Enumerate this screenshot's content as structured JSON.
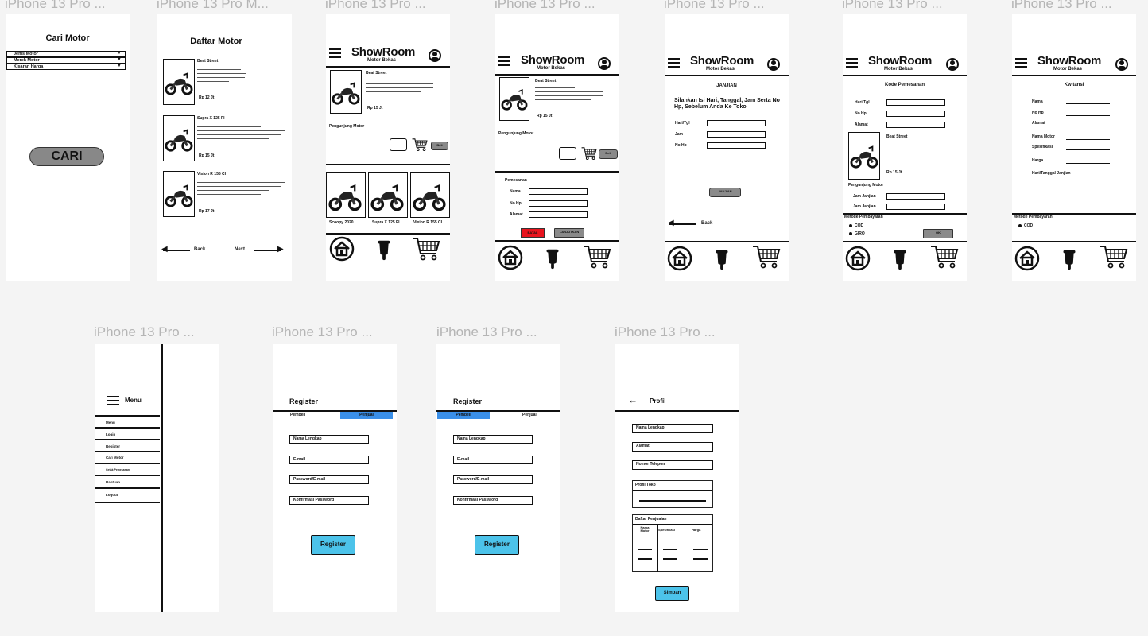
{
  "frame_titles": [
    "iPhone 13 Pro ...",
    "iPhone 13 Pro M...",
    "iPhone 13 Pro ...",
    "iPhone 13 Pro ...",
    "iPhone 13 Pro ...",
    "iPhone 13 Pro ...",
    "iPhone 13 Pro ...",
    "iPhone 13 Pro ...",
    "iPhone 13 Pro ...",
    "iPhone 13 Pro ...",
    "iPhone 13 Pro ..."
  ],
  "brand": {
    "name": "ShowRoom",
    "sub": "Motor Bekas"
  },
  "cari": {
    "title": "Cari Motor",
    "options": [
      "Jenis Motor",
      "Merek Motor",
      "Kisaran Harga"
    ],
    "button": "CARI"
  },
  "daftar": {
    "title": "Daftar Motor",
    "items": [
      {
        "name": "Beat Street",
        "price": "Rp 12 Jt"
      },
      {
        "name": "Supra X 125 FI",
        "price": "Rp 15 Jt"
      },
      {
        "name": "Vixion R 155 CI",
        "price": "Rp 17 Jt"
      }
    ],
    "back": "Back",
    "next": "Next"
  },
  "detail": {
    "item_name": "Beat Street",
    "price": "Rp 15 Jt",
    "pengunjung": "Pengunjung Motor",
    "beli": "Beli",
    "thumbs": [
      "Scoopy 2020",
      "Supra X 125 FI",
      "Vixion R 155 CI"
    ]
  },
  "pemesanan": {
    "item_name": "Beat Street",
    "price": "Rp 15 Jt",
    "pengunjung": "Pengunjung Motor",
    "section": "Pemesanan",
    "fields": [
      "Nama",
      "No Hp",
      "Alamat"
    ],
    "batal": "BATAL",
    "lanjut": "LANJUTKAN",
    "beli": "Beli"
  },
  "janjian": {
    "title": "JANJIAN",
    "desc": "Silahkan Isi Hari, Tanggal, Jam Serta No Hp, Sebelum Anda Ke Toko",
    "fields": [
      "Hari/Tgl",
      "Jam",
      "No Hp"
    ],
    "button": "JANJIAN",
    "back": "Back"
  },
  "kode": {
    "title": "Kode Pemesanan",
    "fields": [
      "Hari/Tgl",
      "No Hp",
      "Alamat"
    ],
    "item_name": "Beat Street",
    "price": "Rp 15 Jt",
    "pengunjung": "Pengunjung Motor",
    "jam_fields": [
      "Jam Janjian",
      "Jam Janjian"
    ],
    "metode": "Metode Pembayaran",
    "options": [
      "COD",
      "GIRO"
    ],
    "ok": "OK"
  },
  "kwitansi": {
    "title": "Kwitansi",
    "fields": [
      "Nama",
      "No Hp",
      "Alamat",
      "Nama Motor",
      "Spesifikasi",
      "Harga",
      "Hari/Tanggal Janjian"
    ],
    "metode": "Metode Pembayaran",
    "option": "COD"
  },
  "menu": {
    "title": "Menu",
    "items": [
      "Menu",
      "Login",
      "Register",
      "Cari Motor",
      "Cetak Pemesanan",
      "Bantuan",
      "Logout"
    ]
  },
  "register1": {
    "title": "Register",
    "tabs": [
      "Pembeli",
      "Penjual"
    ],
    "fields": [
      "Nama Lengkap",
      "E-mail",
      "Password/E-mail",
      "Konfirmasi Password"
    ],
    "button": "Register"
  },
  "register2": {
    "title": "Register",
    "tabs": [
      "Pembeli",
      "Penjual"
    ],
    "fields": [
      "Nama Lengkap",
      "E-mail",
      "Password/E-mail",
      "Konfirmasi Password"
    ],
    "button": "Register"
  },
  "profil": {
    "title": "Profil",
    "fields": [
      "Nama Lengkap",
      "Alamat",
      "Nomor Telepon"
    ],
    "foto": "Profil Toko",
    "daftar": "Daftar Penjualan",
    "cols": [
      "Nama Motor",
      "Spesifikasi",
      "Harga"
    ],
    "button": "Simpan"
  },
  "colors": {
    "accent_blue": "#4cc3ea",
    "danger": "#e8141e",
    "gray_button": "#888888"
  }
}
